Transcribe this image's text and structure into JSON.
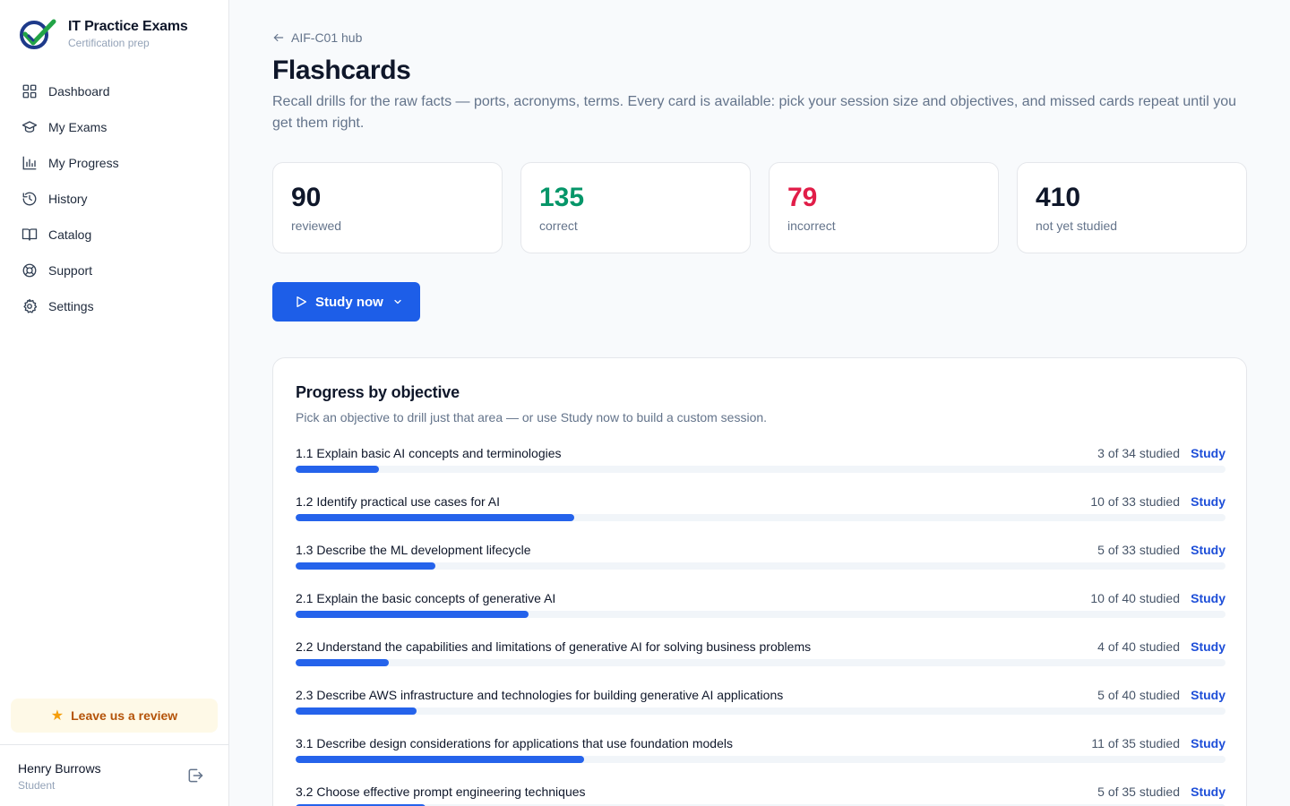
{
  "brand": {
    "title": "IT Practice Exams",
    "subtitle": "Certification prep"
  },
  "nav": [
    {
      "label": "Dashboard",
      "icon": "grid-icon"
    },
    {
      "label": "My Exams",
      "icon": "graduation-cap-icon"
    },
    {
      "label": "My Progress",
      "icon": "bar-chart-icon"
    },
    {
      "label": "History",
      "icon": "history-icon"
    },
    {
      "label": "Catalog",
      "icon": "book-open-icon"
    },
    {
      "label": "Support",
      "icon": "life-buoy-icon"
    },
    {
      "label": "Settings",
      "icon": "gear-icon"
    }
  ],
  "review": {
    "label": "Leave us a review"
  },
  "user": {
    "name": "Henry Burrows",
    "role": "Student"
  },
  "page": {
    "back_label": "AIF-C01 hub",
    "title": "Flashcards",
    "description": "Recall drills for the raw facts — ports, acronyms, terms. Every card is available: pick your session size and objectives, and missed cards repeat until you get them right."
  },
  "stats": [
    {
      "value": "90",
      "label": "reviewed",
      "color": "#0f172a"
    },
    {
      "value": "135",
      "label": "correct",
      "color": "#059669"
    },
    {
      "value": "79",
      "label": "incorrect",
      "color": "#e11d48"
    },
    {
      "value": "410",
      "label": "not yet studied",
      "color": "#0f172a"
    }
  ],
  "study_button": {
    "label": "Study now"
  },
  "objectives_card": {
    "title": "Progress by objective",
    "subtitle": "Pick an objective to drill just that area — or use Study now to build a custom session.",
    "study_link": "Study",
    "items": [
      {
        "name": "1.1 Explain basic AI concepts and terminologies",
        "count": "3 of 34 studied",
        "progress": 0.09
      },
      {
        "name": "1.2 Identify practical use cases for AI",
        "count": "10 of 33 studied",
        "progress": 0.3
      },
      {
        "name": "1.3 Describe the ML development lifecycle",
        "count": "5 of 33 studied",
        "progress": 0.15
      },
      {
        "name": "2.1 Explain the basic concepts of generative AI",
        "count": "10 of 40 studied",
        "progress": 0.25
      },
      {
        "name": "2.2 Understand the capabilities and limitations of generative AI for solving business problems",
        "count": "4 of 40 studied",
        "progress": 0.1
      },
      {
        "name": "2.3 Describe AWS infrastructure and technologies for building generative AI applications",
        "count": "5 of 40 studied",
        "progress": 0.13
      },
      {
        "name": "3.1 Describe design considerations for applications that use foundation models",
        "count": "11 of 35 studied",
        "progress": 0.31
      },
      {
        "name": "3.2 Choose effective prompt engineering techniques",
        "count": "5 of 35 studied",
        "progress": 0.14
      }
    ]
  },
  "colors": {
    "accent": "#1d5ee8",
    "progress": "#2563eb",
    "review_bg": "#fef9e7",
    "review_text": "#b45309"
  }
}
